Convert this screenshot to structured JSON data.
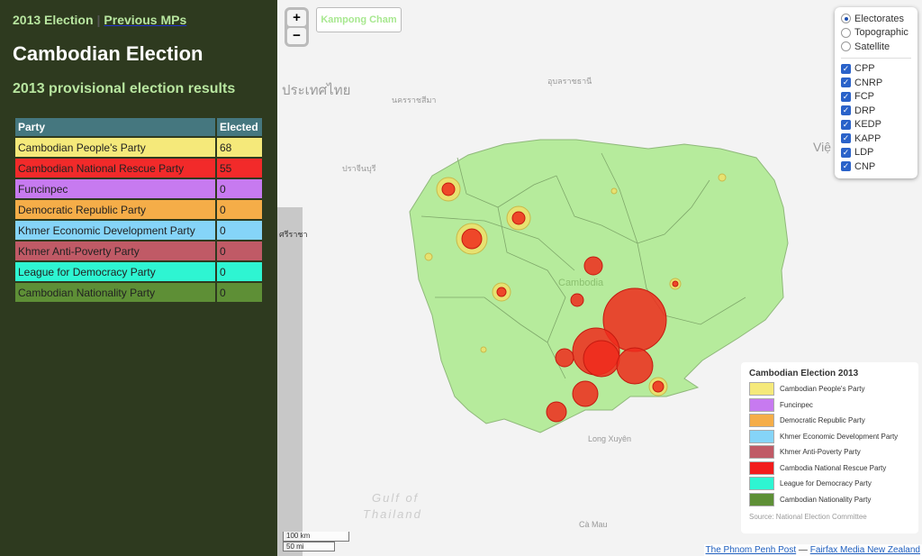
{
  "nav": {
    "current": "2013 Election",
    "separator": "|",
    "link": "Previous MPs"
  },
  "title": "Cambodian Election",
  "subtitle": "2013 provisional election results",
  "table": {
    "headers": [
      "Party",
      "Elected"
    ],
    "rows": [
      {
        "party": "Cambodian People's Party",
        "elected": "68",
        "color": "#f5e97a"
      },
      {
        "party": "Cambodian National Rescue Party",
        "elected": "55",
        "color": "#f22a2a"
      },
      {
        "party": "Funcinpec",
        "elected": "0",
        "color": "#c77af0"
      },
      {
        "party": "Democratic Republic Party",
        "elected": "0",
        "color": "#f5ad48"
      },
      {
        "party": "Khmer Economic Development Party",
        "elected": "0",
        "color": "#85d4f8"
      },
      {
        "party": "Khmer Anti-Poverty Party",
        "elected": "0",
        "color": "#c05a66"
      },
      {
        "party": "League for Democracy Party",
        "elected": "0",
        "color": "#2ef5d2"
      },
      {
        "party": "Cambodian Nationality Party",
        "elected": "0",
        "color": "#5e8f36"
      }
    ]
  },
  "map": {
    "zoom_in": "+",
    "zoom_out": "−",
    "search_value": "Kampong Cham",
    "base_layers": [
      {
        "label": "Electorates",
        "selected": true
      },
      {
        "label": "Topographic",
        "selected": false
      },
      {
        "label": "Satellite",
        "selected": false
      }
    ],
    "overlays": [
      {
        "label": "CPP",
        "checked": true
      },
      {
        "label": "CNRP",
        "checked": true
      },
      {
        "label": "FCP",
        "checked": true
      },
      {
        "label": "DRP",
        "checked": true
      },
      {
        "label": "KEDP",
        "checked": true
      },
      {
        "label": "KAPP",
        "checked": true
      },
      {
        "label": "LDP",
        "checked": true
      },
      {
        "label": "CNP",
        "checked": true
      }
    ],
    "labels": {
      "thailand": "ประเทศไทย",
      "nakhon": "นครราชสีมา",
      "ubon": "อุบลราชธานี",
      "prachin": "ปราจีนบุรี",
      "sriracha": "ศรีราชา",
      "cambodia": "Cambodia",
      "gulf1": "Gulf of",
      "gulf2": "Thailand",
      "longxuyen": "Long Xuyên",
      "camau": "Cà Mau",
      "viet": "Việ"
    },
    "scale": {
      "km": "100 km",
      "mi": "50 mi"
    },
    "legend": {
      "title": "Cambodian Election 2013",
      "items": [
        {
          "label": "Cambodian People's Party",
          "color": "#f5e97a"
        },
        {
          "label": "Funcinpec",
          "color": "#c77af0"
        },
        {
          "label": "Democratic Republic Party",
          "color": "#f5ad48"
        },
        {
          "label": "Khmer Economic Development Party",
          "color": "#85d4f8"
        },
        {
          "label": "Khmer Anti-Poverty Party",
          "color": "#c05a66"
        },
        {
          "label": "Cambodia National Rescue Party",
          "color": "#f21c1c"
        },
        {
          "label": "League for Democracy Party",
          "color": "#2ef5d2"
        },
        {
          "label": "Cambodian Nationality Party",
          "color": "#5e8f36"
        }
      ],
      "source": "Source: National Election Committee"
    },
    "attribution": {
      "link1": "The Phnom Penh Post",
      "sep": " — ",
      "link2": "Fairfax Media New Zealand"
    }
  }
}
